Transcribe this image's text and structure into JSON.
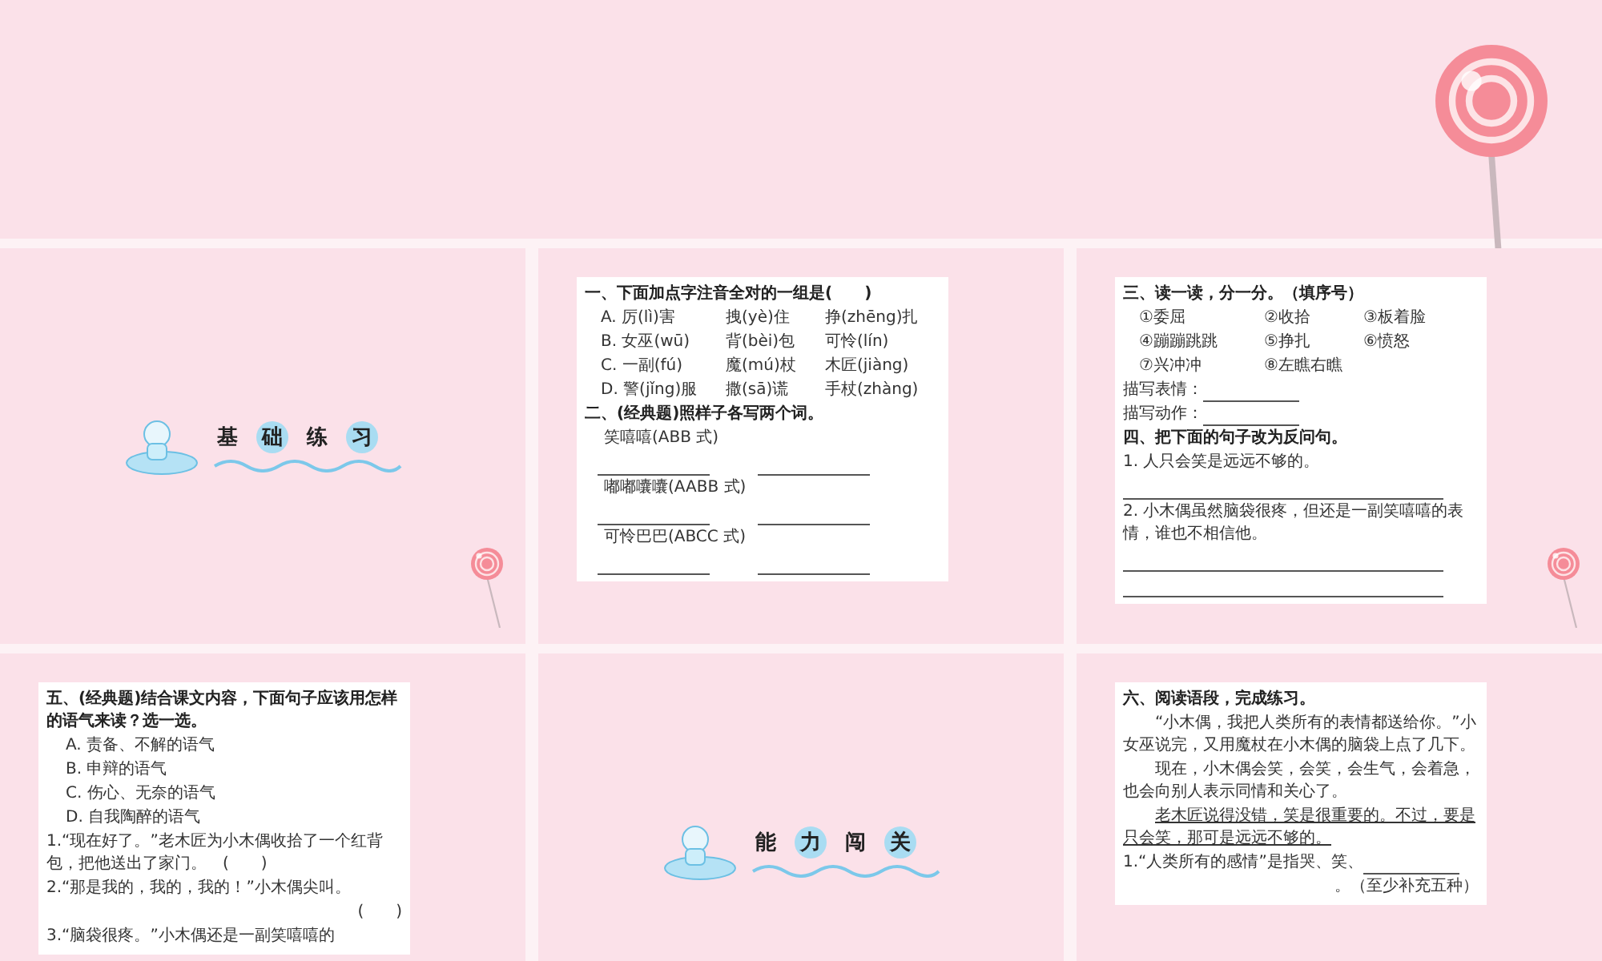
{
  "banner": {
    "kind": "lollipop"
  },
  "slides": [
    {
      "kind": "title",
      "lollipop": true,
      "title_chars": [
        {
          "text": "基",
          "circled": false
        },
        {
          "text": "础",
          "circled": true
        },
        {
          "text": "练",
          "circled": false
        },
        {
          "text": "习",
          "circled": true
        }
      ]
    },
    {
      "kind": "exercise",
      "lollipop": false,
      "lines": [
        {
          "kind": "heading",
          "text": "一、下面加点字注音全对的一组是(　　)"
        },
        {
          "kind": "row",
          "cells": [
            "A. 厉(lì)害",
            "拽(yè)住",
            "挣(zhēng)扎"
          ]
        },
        {
          "kind": "row",
          "cells": [
            "B. 女巫(wū)",
            "背(bèi)包",
            "可怜(lín)"
          ]
        },
        {
          "kind": "row",
          "cells": [
            "C. 一副(fú)",
            "魔(mú)杖",
            "木匠(jiàng)"
          ]
        },
        {
          "kind": "row",
          "cells": [
            "D. 警(jǐng)服",
            "撒(sā)谎",
            "手杖(zhàng)"
          ]
        },
        {
          "kind": "heading",
          "text": "二、(经典题)照样子各写两个词。"
        },
        {
          "kind": "indent",
          "text": "笑嘻嘻(ABB 式)"
        },
        {
          "kind": "blanks"
        },
        {
          "kind": "indent",
          "text": "嘟嘟囔囔(AABB 式)"
        },
        {
          "kind": "blanks"
        },
        {
          "kind": "indent",
          "text": "可怜巴巴(ABCC 式)"
        },
        {
          "kind": "blanks"
        }
      ]
    },
    {
      "kind": "exercise",
      "lollipop": true,
      "lines": [
        {
          "kind": "heading",
          "text": "三、读一读，分一分。（填序号）"
        },
        {
          "kind": "row",
          "cells": [
            "①委屈",
            "②收拾",
            "③板着脸"
          ]
        },
        {
          "kind": "row",
          "cells": [
            "④蹦蹦跳跳",
            "⑤挣扎",
            "⑥愤怒"
          ]
        },
        {
          "kind": "row",
          "cells": [
            "⑦兴冲冲",
            "⑧左瞧右瞧"
          ]
        },
        {
          "kind": "fill",
          "text": "描写表情："
        },
        {
          "kind": "fill",
          "text": "描写动作："
        },
        {
          "kind": "heading",
          "text": "四、把下面的句子改为反问句。"
        },
        {
          "kind": "line",
          "text": "1. 人只会笑是远远不够的。"
        },
        {
          "kind": "blank"
        },
        {
          "kind": "line",
          "text": "2. 小木偶虽然脑袋很疼，但还是一副笑嘻嘻的表情，谁也不相信他。"
        },
        {
          "kind": "blank"
        },
        {
          "kind": "blank"
        }
      ]
    },
    {
      "kind": "exercise",
      "lollipop": false,
      "lines": [
        {
          "kind": "heading",
          "text": "五、(经典题)结合课文内容，下面句子应该用怎样的语气来读？选一选。"
        },
        {
          "kind": "indent",
          "text": "A. 责备、不解的语气"
        },
        {
          "kind": "indent",
          "text": "B. 申辩的语气"
        },
        {
          "kind": "indent",
          "text": "C. 伤心、无奈的语气"
        },
        {
          "kind": "indent",
          "text": "D. 自我陶醉的语气"
        },
        {
          "kind": "line",
          "text": "1.“现在好了。”老木匠为小木偶收拾了一个红背包，把他送出了家门。　(　　)"
        },
        {
          "kind": "line",
          "text": "2.“那是我的，我的，我的！”小木偶尖叫。"
        },
        {
          "kind": "right",
          "text": "(　　)"
        },
        {
          "kind": "line",
          "text": "3.“脑袋很疼。”小木偶还是一副笑嘻嘻的"
        }
      ]
    },
    {
      "kind": "title",
      "lollipop": false,
      "title_chars": [
        {
          "text": "能",
          "circled": false
        },
        {
          "text": "力",
          "circled": true
        },
        {
          "text": "闯",
          "circled": false
        },
        {
          "text": "关",
          "circled": true
        }
      ]
    },
    {
      "kind": "exercise",
      "lollipop": false,
      "lines": [
        {
          "kind": "heading",
          "text": "六、阅读语段，完成练习。"
        },
        {
          "kind": "para",
          "text": "“小木偶，我把人类所有的表情都送给你。”小女巫说完，又用魔杖在小木偶的脑袋上点了几下。"
        },
        {
          "kind": "para",
          "text": "现在，小木偶会笑，会笑，会生气，会着急，也会向别人表示同情和关心了。"
        },
        {
          "kind": "underlined",
          "text": "老木匠说得没错，笑是很重要的。不过，要是只会笑，那可是远远不够的。"
        },
        {
          "kind": "fill",
          "text": "1.“人类所有的感情”是指哭、笑、"
        },
        {
          "kind": "right",
          "text": "。（至少补充五种）"
        }
      ]
    }
  ]
}
